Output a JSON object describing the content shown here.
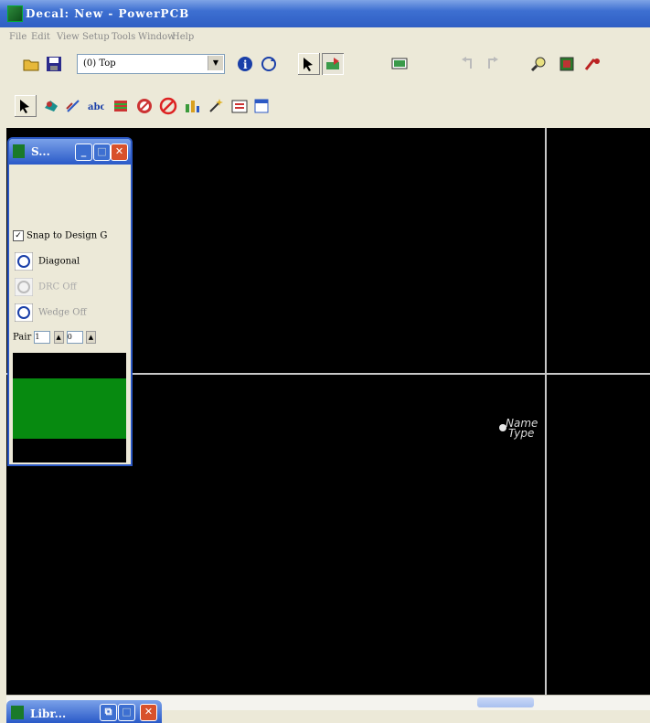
{
  "window": {
    "title": "Decal: New - PowerPCB"
  },
  "menu": [
    "File",
    "Edit",
    "View",
    "Setup",
    "Tools",
    "Window",
    "Help"
  ],
  "toolbar": {
    "layer_value": "(0) Top"
  },
  "canvas": {
    "origin_label_line1": "Name",
    "origin_label_line2": "Type"
  },
  "panel": {
    "title": "S...",
    "snap_label": "Snap to Design G",
    "diagonal_label": "Diagonal",
    "drc_label": "DRC Off",
    "wedge_label": "Wedge Off",
    "pair_label": "Pair",
    "pair_value1": "1",
    "pair_value2": "0"
  },
  "minimized_window": {
    "title": "Libr..."
  },
  "colors": {
    "canvas_bg": "#000000",
    "swatch": "#078a10",
    "titlebar": "#2f5fc4"
  }
}
